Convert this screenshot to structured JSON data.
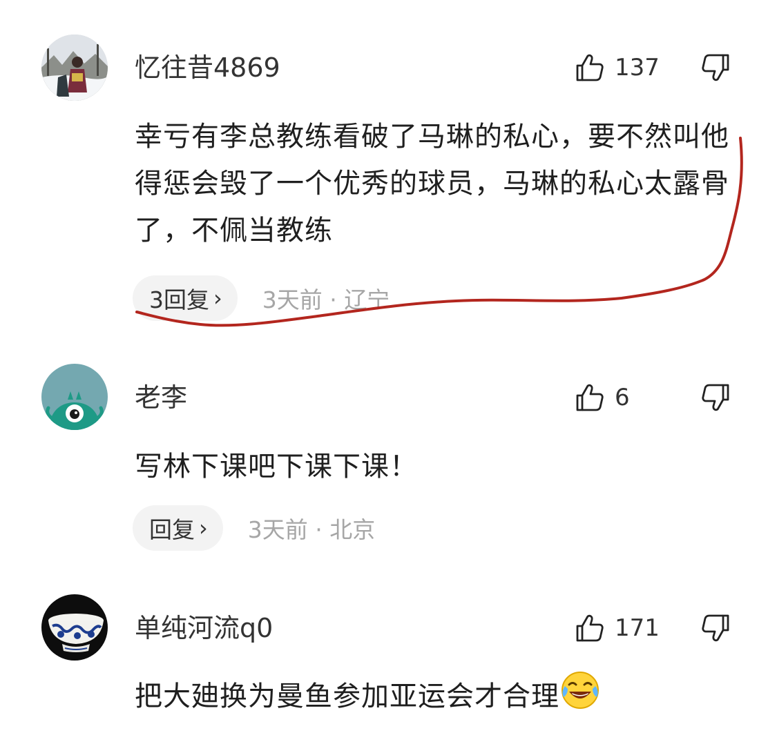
{
  "comments": [
    {
      "username": "忆往昔4869",
      "like_count": "137",
      "text": "幸亏有李总教练看破了马琳的私心，要不然叫他得惩会毁了一个优秀的球员，马琳的私心太露骨了，不佩当教练",
      "reply_label": "3回复",
      "reply_chevron": "›",
      "meta": "3天前 · 辽宁",
      "avatar": "photo-avatar-snow"
    },
    {
      "username": "老李",
      "like_count": "6",
      "text": "写林下课吧下课下课！",
      "reply_label": "回复",
      "reply_chevron": "›",
      "meta": "3天前 · 北京",
      "avatar": "green-monster-avatar"
    },
    {
      "username": "单纯河流q0",
      "like_count": "171",
      "text": "把大廸换为曼鱼参加亚运会才合理",
      "emoji": "laughing-crying-emoji",
      "avatar": "porcelain-cup-avatar"
    }
  ],
  "icons": {
    "like": "thumbs-up-icon",
    "dislike": "thumbs-down-icon"
  },
  "colors": {
    "annotation_stroke": "#b3261e",
    "meta_text": "#a6a6a6",
    "pill_bg": "#f3f3f3"
  }
}
